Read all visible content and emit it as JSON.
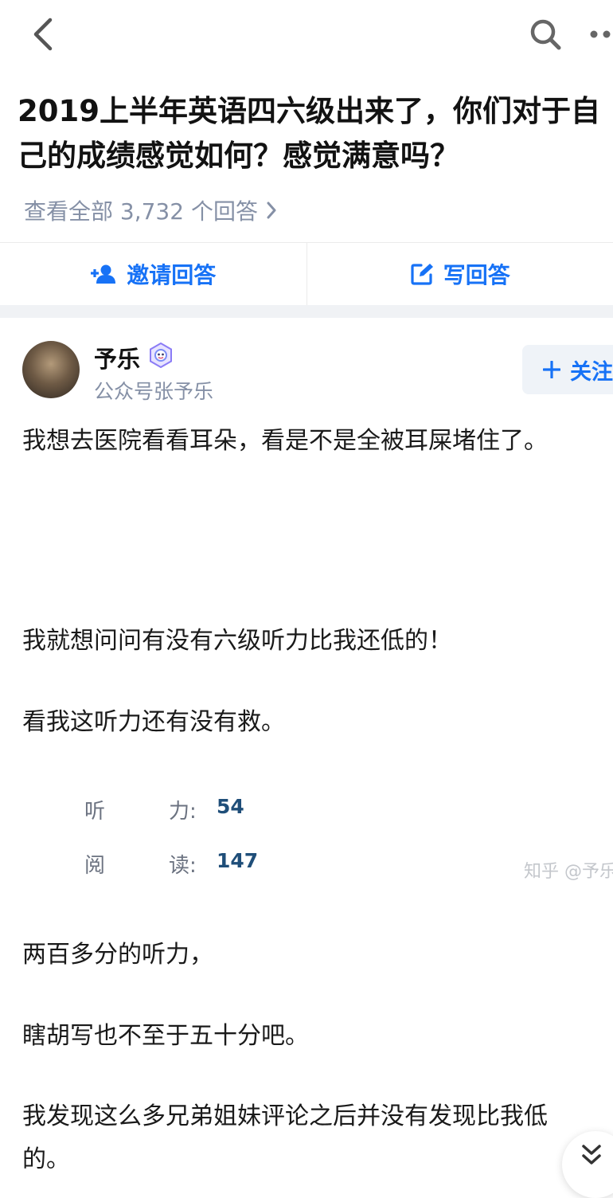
{
  "header": {
    "question_title_line1": "2019上半年英语四六级出来了，你们对于自",
    "question_title_line2": "己的成绩感觉如何？感觉满意吗？",
    "view_all": "查看全部 3,732 个回答"
  },
  "actions": {
    "invite_label": "邀请回答",
    "write_label": "写回答"
  },
  "author": {
    "name": "予乐",
    "description": "公众号张予乐",
    "follow_label": "关注"
  },
  "content": {
    "p1": "我想去医院看看耳朵，看是不是全被耳屎堵住了。",
    "p2": "我就想问问有没有六级听力比我还低的！",
    "p3": "看我这听力还有没有救。",
    "scores": [
      {
        "label_a": "听",
        "label_b": "力:",
        "value": "54"
      },
      {
        "label_a": "阅",
        "label_b": "读:",
        "value": "147"
      }
    ],
    "watermark": "知乎 @予乐",
    "p4": "两百多分的听力，",
    "p5": "瞎胡写也不至于五十分吧。",
    "p6": "我发现这么多兄弟姐妹评论之后并没有发现比我低",
    "p7": "的。"
  },
  "icons": {
    "back": "chevron-left-icon",
    "search": "search-icon",
    "more": "more-icon",
    "invite": "add-user-icon",
    "write": "edit-icon",
    "badge": "verified-badge-icon",
    "follow": "plus-icon",
    "scroll": "double-chevron-down-icon"
  },
  "colors": {
    "accent": "#1772f6",
    "muted": "#8590a6",
    "score_value": "#1f4e79"
  }
}
